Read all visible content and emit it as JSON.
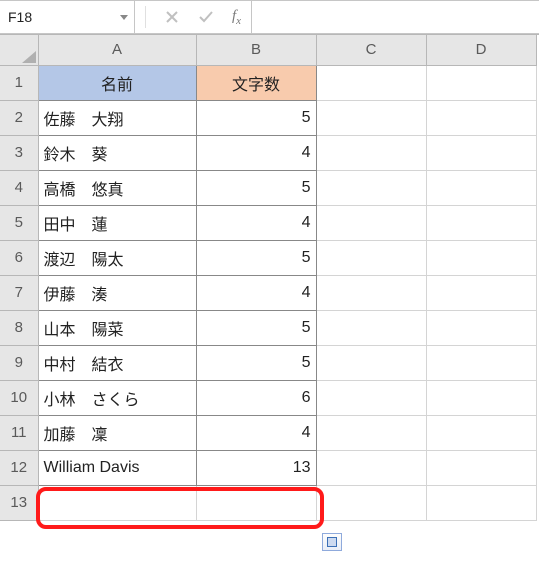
{
  "formula_bar": {
    "name_box": "F18",
    "formula": ""
  },
  "columns": [
    "A",
    "B",
    "C",
    "D"
  ],
  "rows": [
    "1",
    "2",
    "3",
    "4",
    "5",
    "6",
    "7",
    "8",
    "9",
    "10",
    "11",
    "12",
    "13"
  ],
  "headers": {
    "A": "名前",
    "B": "文字数"
  },
  "data": [
    {
      "name": "佐藤　大翔",
      "len": "5"
    },
    {
      "name": "鈴木　葵",
      "len": "4"
    },
    {
      "name": "高橋　悠真",
      "len": "5"
    },
    {
      "name": "田中　蓮",
      "len": "4"
    },
    {
      "name": "渡辺　陽太",
      "len": "5"
    },
    {
      "name": "伊藤　湊",
      "len": "4"
    },
    {
      "name": "山本　陽菜",
      "len": "5"
    },
    {
      "name": "中村　結衣",
      "len": "5"
    },
    {
      "name": "小林　さくら",
      "len": "6"
    },
    {
      "name": "加藤　凜",
      "len": "4"
    },
    {
      "name": "William Davis",
      "len": "13"
    }
  ],
  "chart_data": {
    "type": "table",
    "title": "",
    "columns": [
      "名前",
      "文字数"
    ],
    "rows": [
      [
        "佐藤　大翔",
        5
      ],
      [
        "鈴木　葵",
        4
      ],
      [
        "高橋　悠真",
        5
      ],
      [
        "田中　蓮",
        4
      ],
      [
        "渡辺　陽太",
        5
      ],
      [
        "伊藤　湊",
        4
      ],
      [
        "山本　陽菜",
        5
      ],
      [
        "中村　結衣",
        5
      ],
      [
        "小林　さくら",
        6
      ],
      [
        "加藤　凜",
        4
      ],
      [
        "William Davis",
        13
      ]
    ]
  }
}
